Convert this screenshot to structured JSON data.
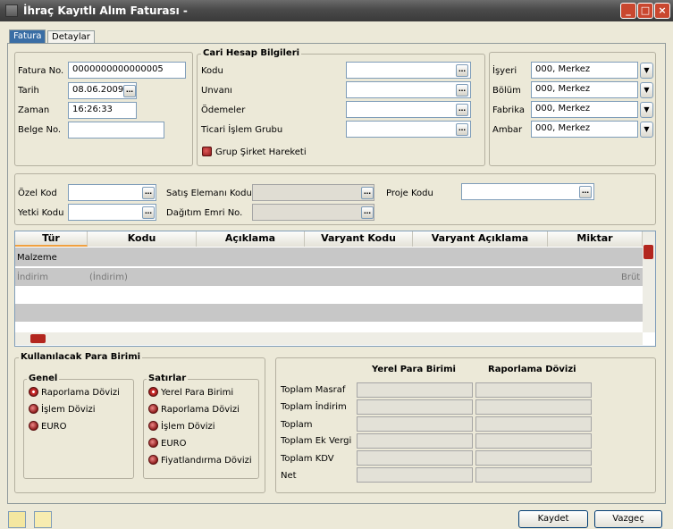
{
  "window": {
    "title": "İhraç Kayıtlı Alım Faturası -",
    "min": "_",
    "max": "□",
    "close": "×"
  },
  "tabs": [
    "Fatura",
    "Detaylar"
  ],
  "left": {
    "fatura_no_label": "Fatura No.",
    "fatura_no": "0000000000000005",
    "tarih_label": "Tarih",
    "tarih": "08.06.2009",
    "zaman_label": "Zaman",
    "zaman": "16:26:33",
    "belge_label": "Belge No.",
    "belge": ""
  },
  "cari": {
    "title": "Cari Hesap Bilgileri",
    "kodu": "Kodu",
    "unvani": "Unvanı",
    "odemeler": "Ödemeler",
    "ticari": "Ticari İşlem Grubu",
    "grup": "Grup Şirket Hareketi"
  },
  "org": {
    "isyeri_label": "İşyeri",
    "isyeri": "000, Merkez",
    "bolum_label": "Bölüm",
    "bolum": "000, Merkez",
    "fabrika_label": "Fabrika",
    "fabrika": "000, Merkez",
    "ambar_label": "Ambar",
    "ambar": "000, Merkez"
  },
  "mid": {
    "ozel": "Özel Kod",
    "yetki": "Yetki Kodu",
    "satis": "Satış Elemanı Kodu",
    "dagitim": "Dağıtım Emri No.",
    "proje": "Proje Kodu"
  },
  "grid": {
    "headers": [
      "Tür",
      "Kodu",
      "Açıklama",
      "Varyant Kodu",
      "Varyant Açıklama",
      "Miktar"
    ],
    "row1": "Malzeme",
    "row2_tur": "İndirim",
    "row2_kodu": "(İndirim)",
    "row2_miktar": "Brüt"
  },
  "currency": {
    "title": "Kullanılacak Para Birimi",
    "genel": "Genel",
    "genel_opts": [
      "Raporlama Dövizi",
      "İşlem Dövizi",
      "EURO"
    ],
    "satirlar": "Satırlar",
    "satir_opts": [
      "Yerel Para Birimi",
      "Raporlama Dövizi",
      "İşlem Dövizi",
      "EURO",
      "Fiyatlandırma Dövizi"
    ]
  },
  "totals": {
    "col1": "Yerel Para Birimi",
    "col2": "Raporlama Dövizi",
    "rows": [
      "Toplam Masraf",
      "Toplam İndirim",
      "Toplam",
      "Toplam Ek Vergi",
      "Toplam KDV",
      "Net"
    ]
  },
  "buttons": {
    "kaydet": "Kaydet",
    "vazgec": "Vazgeç"
  }
}
